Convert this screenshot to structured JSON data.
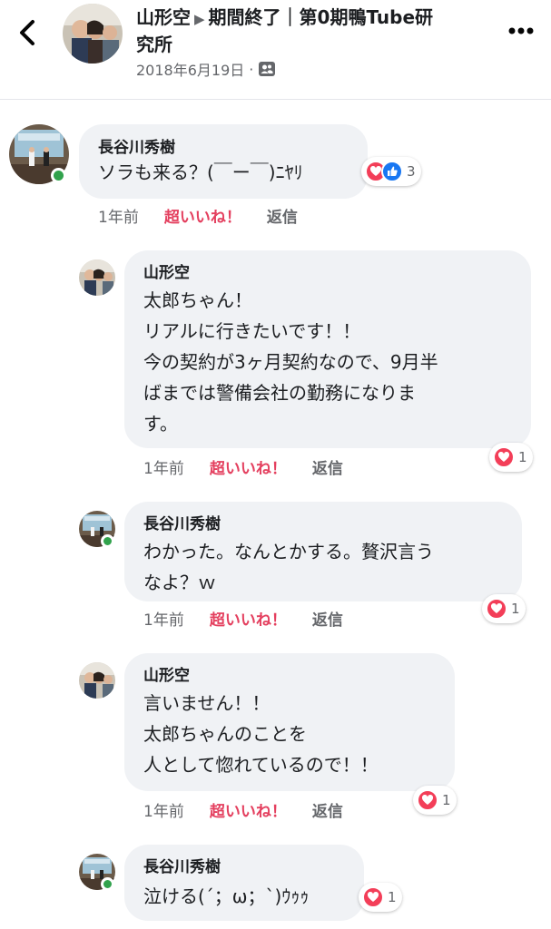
{
  "header": {
    "title": "山形空 ▶ 期間終了｜第0期鴨Tube研究所",
    "title_part1": "山形空",
    "title_arrow": "▶",
    "title_part2": "期間終了｜第0期鴨Tube研",
    "title_part3": "究所",
    "date": "2018年6月19日",
    "dot": "·",
    "back_icon": "chevron-left-icon",
    "more_icon": "ellipsis-icon",
    "privacy_icon": "friends-icon"
  },
  "colors": {
    "like_red": "#e4405f",
    "bubble": "#f0f2f5",
    "online_green": "#31a24c",
    "heart": "#f33e58",
    "thumb": "#1877f2"
  },
  "comments": [
    {
      "author": "長谷川秀樹",
      "lines": [
        "ソラも来る？(￣ー￣)ﾆﾔﾘ"
      ],
      "time": "1年前",
      "like": "超いいね！",
      "reply": "返信",
      "reactions": [
        "heart",
        "like"
      ],
      "reaction_count": "3"
    },
    {
      "author": "山形空",
      "lines": [
        "太郎ちゃん！",
        "リアルに行きたいです！！",
        "今の契約が3ヶ月契約なので、9月半",
        "ばまでは警備会社の勤務になりま",
        "す。"
      ],
      "time": "1年前",
      "like": "超いいね！",
      "reply": "返信",
      "reactions": [
        "heart"
      ],
      "reaction_count": "1"
    },
    {
      "author": "長谷川秀樹",
      "lines": [
        "わかった。なんとかする。贅沢言う",
        "なよ？ｗ"
      ],
      "time": "1年前",
      "like": "超いいね！",
      "reply": "返信",
      "reactions": [
        "heart"
      ],
      "reaction_count": "1"
    },
    {
      "author": "山形空",
      "lines": [
        "言いません！！",
        "太郎ちゃんのことを",
        "人として惚れているので！！"
      ],
      "time": "1年前",
      "like": "超いいね！",
      "reply": "返信",
      "reactions": [
        "heart"
      ],
      "reaction_count": "1"
    },
    {
      "author": "長谷川秀樹",
      "lines": [
        "泣ける(´；ω；`)ｳｩｩ"
      ],
      "time": "",
      "like": "",
      "reply": "",
      "reactions": [
        "heart"
      ],
      "reaction_count": "1"
    }
  ]
}
